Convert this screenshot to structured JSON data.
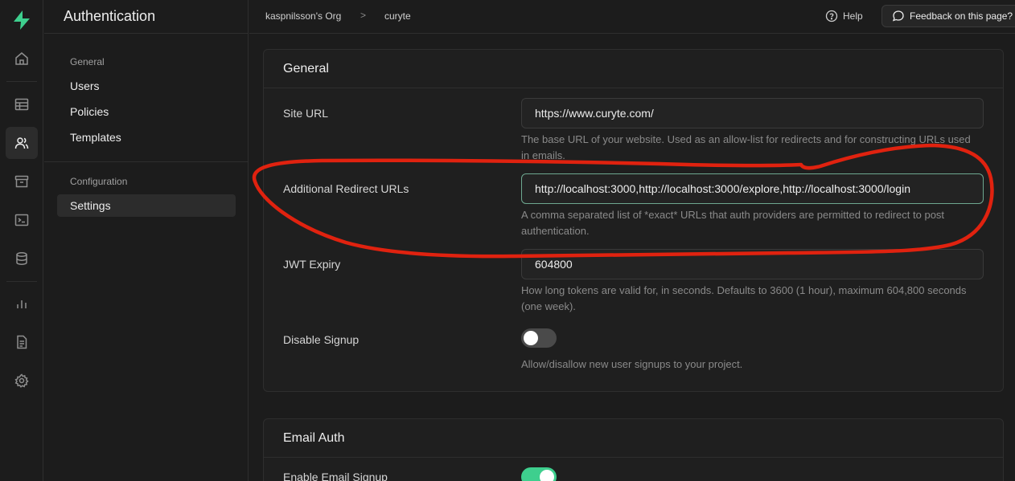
{
  "app": {
    "icons": [
      "supabase-logo-icon",
      "home-icon",
      "table-editor-icon",
      "users-icon",
      "storage-icon",
      "terminal-icon",
      "database-icon",
      "reports-icon",
      "docs-icon",
      "settings-icon"
    ],
    "accent": "#3ecf8e"
  },
  "sidebar": {
    "title": "Authentication",
    "general_header": "General",
    "items": [
      "Users",
      "Policies",
      "Templates"
    ],
    "config_header": "Configuration",
    "config_items": [
      "Settings"
    ]
  },
  "topbar": {
    "org": "kaspnilsson's Org",
    "sep": ">",
    "project": "curyte",
    "help": "Help",
    "feedback": "Feedback on this page?"
  },
  "general": {
    "title": "General",
    "site_url_label": "Site URL",
    "site_url_value": "https://www.curyte.com/",
    "site_url_help": "The base URL of your website. Used as an allow-list for redirects and for constructing URLs used in emails.",
    "redirect_label": "Additional Redirect URLs",
    "redirect_value": "http://localhost:3000,http://localhost:3000/explore,http://localhost:3000/login",
    "redirect_help": "A comma separated list of *exact* URLs that auth providers are permitted to redirect to post authentication.",
    "jwt_label": "JWT Expiry",
    "jwt_value": "604800",
    "jwt_help": "How long tokens are valid for, in seconds. Defaults to 3600 (1 hour), maximum 604,800 seconds (one week).",
    "signup_label": "Disable Signup",
    "signup_enabled": false,
    "signup_help": "Allow/disallow new user signups to your project."
  },
  "email_auth": {
    "title": "Email Auth",
    "enable_label": "Enable Email Signup",
    "enable_enabled": true
  },
  "annotation": {
    "color": "#e0220f"
  }
}
